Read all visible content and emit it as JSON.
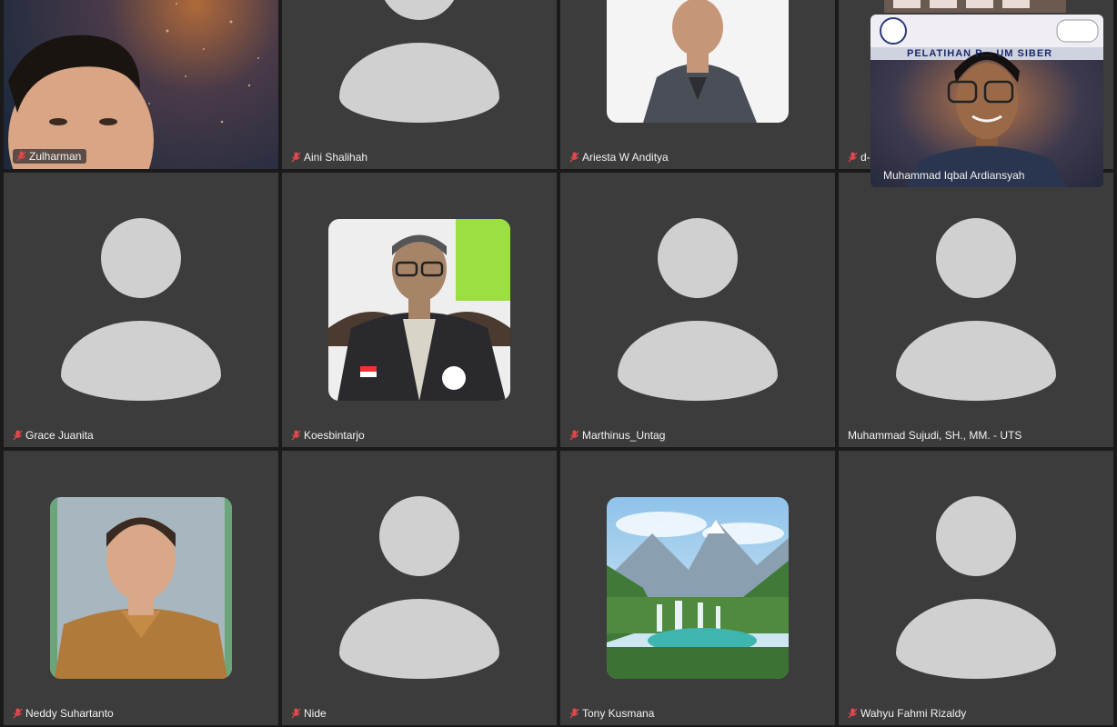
{
  "participants": [
    {
      "name": "Zulharman",
      "muted": true
    },
    {
      "name": "Aini Shalihah",
      "muted": true
    },
    {
      "name": "Ariesta W Anditya",
      "muted": true
    },
    {
      "name": "d-",
      "muted": true
    },
    {
      "name": "Grace Juanita",
      "muted": true
    },
    {
      "name": "Koesbintarjo",
      "muted": true
    },
    {
      "name": "Marthinus_Untag",
      "muted": true
    },
    {
      "name": "Muhammad Sujudi, SH., MM. - UTS",
      "muted": false
    },
    {
      "name": "Neddy Suhartanto",
      "muted": true
    },
    {
      "name": "Nide",
      "muted": true
    },
    {
      "name": "Tony Kusmana",
      "muted": true
    },
    {
      "name": "Wahyu Fahmi Rizaldy",
      "muted": true
    }
  ],
  "floating_video": {
    "name": "Muhammad Iqbal Ardiansyah",
    "banner_text": "PELATIHAN P... UM SIBER"
  },
  "colors": {
    "tile_bg": "#3c3c3c",
    "avatar": "#d0d0d0",
    "muted_mic": "#e5484d"
  }
}
